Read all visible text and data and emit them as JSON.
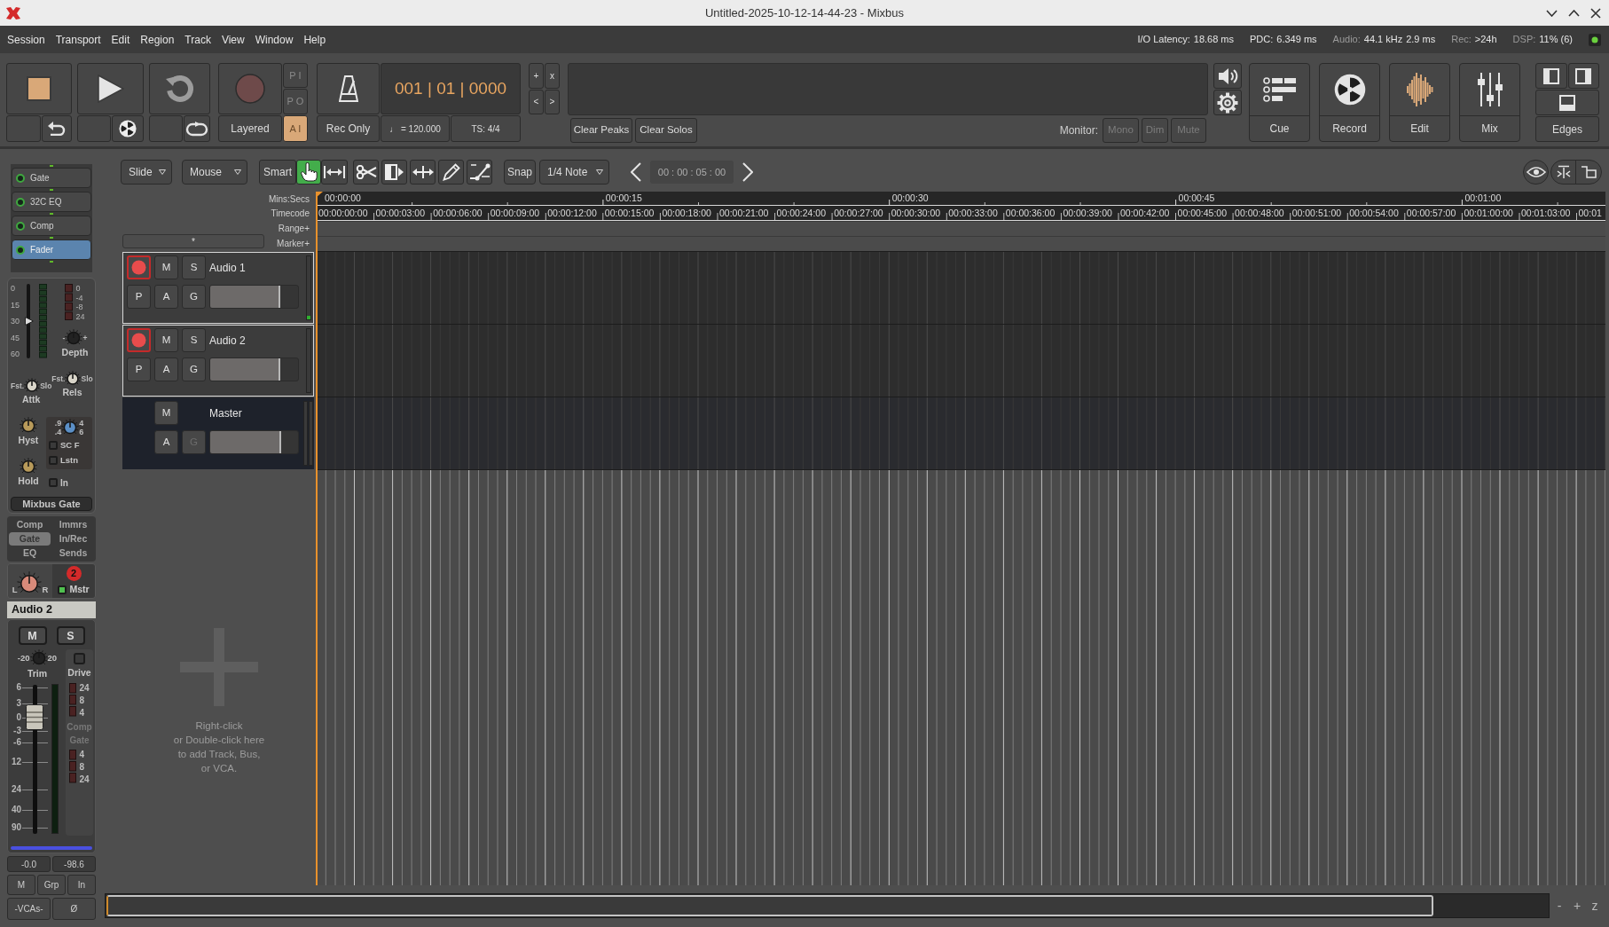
{
  "window": {
    "title": "Untitled-2025-10-12-14-44-23 - Mixbus"
  },
  "menu": [
    "Session",
    "Transport",
    "Edit",
    "Region",
    "Track",
    "View",
    "Window",
    "Help"
  ],
  "status": [
    {
      "kind": "bright",
      "label": "I/O Latency:",
      "values": [
        "18.68 ms"
      ]
    },
    {
      "kind": "bright",
      "label": "PDC:",
      "values": [
        "6.349 ms"
      ]
    },
    {
      "kind": "dim",
      "label": "Audio:",
      "values": [
        "44.1 kHz",
        "2.9 ms"
      ]
    },
    {
      "kind": "dim",
      "label": "Rec:",
      "values": [
        ">24h"
      ]
    },
    {
      "kind": "dim",
      "label": "DSP:",
      "values": [
        "11% (6)"
      ]
    }
  ],
  "status_led": {
    "on": true
  },
  "transport": {
    "buttons": [
      {
        "kind": "stop",
        "active": true
      },
      {
        "kind": "play",
        "active": false
      },
      {
        "kind": "loop",
        "active": false
      },
      {
        "kind": "record",
        "active": false
      }
    ],
    "record_mode": "Layered",
    "punch": [
      {
        "label": "P I",
        "on": false
      },
      {
        "label": "P O",
        "on": false
      },
      {
        "label": "A I",
        "on": true
      }
    ],
    "click": "Rec Only",
    "clock": "001 | 01 | 0000",
    "tempo": "♩ = 120.000",
    "time_signature": "TS: 4/4",
    "nudge": [
      "+",
      "x",
      "<",
      ">"
    ]
  },
  "display": {
    "clear_buttons": [
      "Clear Peaks",
      "Clear Solos"
    ],
    "monitor_label": "Monitor:",
    "monitor": [
      {
        "label": "Mono",
        "disabled": true
      },
      {
        "label": "Dim",
        "disabled": true
      },
      {
        "label": "Mute",
        "disabled": true
      }
    ]
  },
  "windows": [
    {
      "kind": "cue",
      "label": "Cue",
      "selected": false
    },
    {
      "kind": "record",
      "label": "Record",
      "selected": false
    },
    {
      "kind": "edit",
      "label": "Edit",
      "selected": true
    },
    {
      "kind": "mix",
      "label": "Mix",
      "selected": false
    },
    {
      "kind": "edges",
      "label": "Edges",
      "selected": false
    }
  ],
  "toolbar": {
    "dropdowns": [
      "Slide",
      "Mouse"
    ],
    "smart": {
      "label": "Smart",
      "on": false
    },
    "tools": [
      {
        "kind": "grab",
        "selected": true
      },
      {
        "kind": "range",
        "selected": false
      }
    ],
    "edit_tools": [
      {
        "kind": "cut",
        "selected": false
      },
      {
        "kind": "stretch",
        "selected": false
      },
      {
        "kind": "audition",
        "selected": false
      },
      {
        "kind": "draw",
        "selected": false
      },
      {
        "kind": "content",
        "selected": false
      }
    ],
    "snap": {
      "label": "Snap",
      "on": false
    },
    "grid": "1/4 Note",
    "nudge_clock": "00 : 00 : 05 : 00"
  },
  "ruler": {
    "labels": [
      "Mins:Secs",
      "Timecode",
      "Range+",
      "Marker+"
    ],
    "minsecs": [
      "00:00:00",
      "00:00:15",
      "00:00:30",
      "00:00:45",
      "00:01:00"
    ],
    "timecode": [
      "00:00:00:00",
      "00:00:03:00",
      "00:00:06:00",
      "00:00:09:00",
      "00:00:12:00",
      "00:00:15:00",
      "00:00:18:00",
      "00:00:21:00",
      "00:00:24:00",
      "00:00:27:00",
      "00:00:30:00",
      "00:00:33:00",
      "00:00:36:00",
      "00:00:39:00",
      "00:00:42:00",
      "00:00:45:00",
      "00:00:48:00",
      "00:00:51:00",
      "00:00:54:00",
      "00:00:57:00",
      "00:01:00:00",
      "00:01:03:00",
      "00:01"
    ]
  },
  "track_filter": "*",
  "tracks": [
    {
      "kind": "audio",
      "name": "Audio 1",
      "selected": true,
      "rec_armed": true,
      "buttons": [
        {
          "kind": "mute",
          "label": "M",
          "disabled": false
        },
        {
          "kind": "solo",
          "label": "S",
          "disabled": false
        },
        {
          "kind": "playlist",
          "label": "P",
          "disabled": false
        },
        {
          "kind": "automation",
          "label": "A",
          "disabled": false
        },
        {
          "kind": "group",
          "label": "G",
          "disabled": false
        }
      ],
      "gain": {
        "level": 0.8
      },
      "meter": {
        "level": 0.06
      }
    },
    {
      "kind": "audio",
      "name": "Audio 2",
      "selected": true,
      "rec_armed": true,
      "buttons": [
        {
          "kind": "mute",
          "label": "M",
          "disabled": false
        },
        {
          "kind": "solo",
          "label": "S",
          "disabled": false
        },
        {
          "kind": "playlist",
          "label": "P",
          "disabled": false
        },
        {
          "kind": "automation",
          "label": "A",
          "disabled": false
        },
        {
          "kind": "group",
          "label": "G",
          "disabled": false
        }
      ],
      "gain": {
        "level": 0.8
      }
    },
    {
      "kind": "master",
      "name": "Master",
      "selected": false,
      "buttons": [
        {
          "kind": "mute",
          "label": "M",
          "disabled": false
        },
        {
          "kind": "automation",
          "label": "A",
          "disabled": false
        },
        {
          "kind": "group",
          "label": "G",
          "disabled": true
        }
      ],
      "gain": {
        "level": 0.81
      }
    }
  ],
  "hint": "Right-click\nor Double-click here\nto add Track, Bus,\nor VCA.",
  "zoom_controls": [
    "-",
    "+",
    "z"
  ],
  "strip": {
    "plugins": [
      {
        "name": "Gate",
        "selected": false
      },
      {
        "name": "32C EQ",
        "selected": false
      },
      {
        "name": "Comp",
        "selected": false
      },
      {
        "name": "Fader",
        "selected": true
      }
    ],
    "gate": {
      "threshold": {
        "scale": [
          "0",
          "15",
          "30",
          "45",
          "60"
        ],
        "level": 0.5
      },
      "reduction_scale": [
        "0",
        "-4",
        "-8",
        "24"
      ],
      "knobs": [
        {
          "kind": "depth",
          "label": "Depth",
          "min": "-",
          "max": "+"
        },
        {
          "kind": "attack",
          "label": "Attk",
          "min": "Fst.",
          "max": "Slo"
        },
        {
          "kind": "release",
          "label": "Rels",
          "min": "Fst.",
          "max": "Slo"
        },
        {
          "kind": "hysteresis",
          "label": "Hyst"
        },
        {
          "kind": "hold",
          "label": "Hold"
        }
      ],
      "sidechain": {
        "marks": [
          ".9",
          "4",
          ".4",
          "6"
        ],
        "options": [
          {
            "label": "SC F",
            "checked": false
          },
          {
            "label": "Lstn",
            "checked": false
          }
        ]
      },
      "input": {
        "label": "In",
        "checked": false
      },
      "title": "Mixbus Gate"
    },
    "tabs": [
      {
        "label": "Comp",
        "selected": false
      },
      {
        "label": "Immrs",
        "selected": false
      },
      {
        "label": "Gate",
        "selected": true
      },
      {
        "label": "In/Rec",
        "selected": false
      },
      {
        "label": "EQ",
        "selected": false
      },
      {
        "label": "Sends",
        "selected": false
      }
    ],
    "pan": {
      "left": "L",
      "right": "R"
    },
    "bus": {
      "number": "2",
      "label": "Mstr",
      "checked": true
    },
    "name": "Audio 2",
    "mute": "M",
    "solo": "S",
    "trim": {
      "min": "-20",
      "max": "20",
      "label": "Trim"
    },
    "drive": {
      "label": "Drive",
      "checked": false
    },
    "fader": {
      "scale": [
        "6",
        "3",
        "0",
        "-3",
        "-6",
        "12",
        "24",
        "40",
        "90"
      ],
      "level": 0.78
    },
    "comp_meter": {
      "scale": [
        "24",
        "8",
        "4"
      ],
      "label": "Comp"
    },
    "gate_meter": {
      "label": "Gate",
      "scale": [
        "4",
        "8",
        "24"
      ]
    },
    "readouts": [
      "-0.0",
      "-98.6"
    ],
    "buttons": [
      "M",
      "Grp",
      "In",
      "-VCAs-",
      "Ø"
    ]
  }
}
